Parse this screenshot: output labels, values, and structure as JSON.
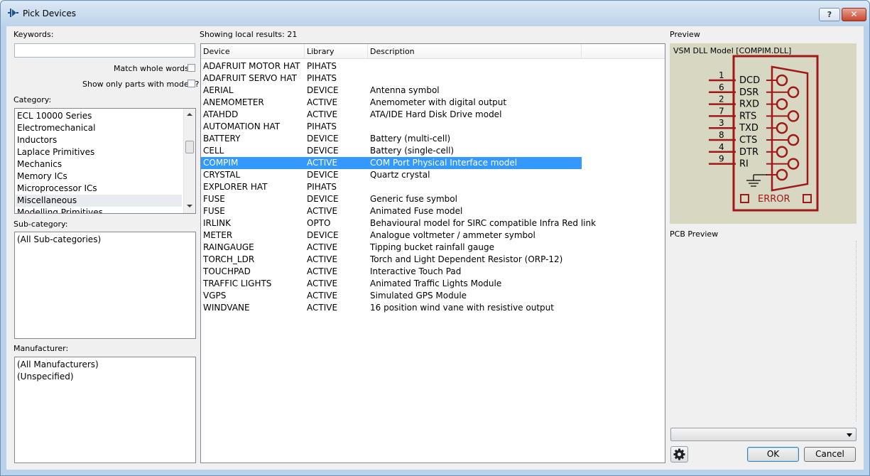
{
  "window": {
    "title": "Pick Devices",
    "help_label": "?",
    "close_label": "✕"
  },
  "search": {
    "keywords_label": "Keywords:",
    "keywords_value": "",
    "match_whole_words_label": "Match whole words?",
    "match_whole_words_checked": false,
    "only_models_label": "Show only parts with models?",
    "only_models_checked": false
  },
  "category": {
    "label": "Category:",
    "items": [
      "ECL 10000 Series",
      "Electromechanical",
      "Inductors",
      "Laplace Primitives",
      "Mechanics",
      "Memory ICs",
      "Microprocessor ICs",
      "Miscellaneous",
      "Modelling Primitives"
    ],
    "selected": "Miscellaneous"
  },
  "subcategory": {
    "label": "Sub-category:",
    "items": [
      "(All Sub-categories)"
    ]
  },
  "manufacturer": {
    "label": "Manufacturer:",
    "items": [
      "(All Manufacturers)",
      "(Unspecified)"
    ]
  },
  "results": {
    "summary": "Showing local results: 21",
    "columns": [
      "Device",
      "Library",
      "Description"
    ],
    "selected_device": "COMPIM",
    "rows": [
      {
        "device": "ADAFRUIT MOTOR HAT",
        "library": "PIHATS",
        "description": ""
      },
      {
        "device": "ADAFRUIT SERVO HAT",
        "library": "PIHATS",
        "description": ""
      },
      {
        "device": "AERIAL",
        "library": "DEVICE",
        "description": "Antenna symbol"
      },
      {
        "device": "ANEMOMETER",
        "library": "ACTIVE",
        "description": "Anemometer with digital output"
      },
      {
        "device": "ATAHDD",
        "library": "ACTIVE",
        "description": "ATA/IDE Hard Disk Drive model"
      },
      {
        "device": "AUTOMATION HAT",
        "library": "PIHATS",
        "description": ""
      },
      {
        "device": "BATTERY",
        "library": "DEVICE",
        "description": "Battery (multi-cell)"
      },
      {
        "device": "CELL",
        "library": "DEVICE",
        "description": "Battery (single-cell)"
      },
      {
        "device": "COMPIM",
        "library": "ACTIVE",
        "description": "COM Port Physical Interface model"
      },
      {
        "device": "CRYSTAL",
        "library": "DEVICE",
        "description": "Quartz crystal"
      },
      {
        "device": "EXPLORER HAT",
        "library": "PIHATS",
        "description": ""
      },
      {
        "device": "FUSE",
        "library": "DEVICE",
        "description": "Generic fuse symbol"
      },
      {
        "device": "FUSE",
        "library": "ACTIVE",
        "description": "Animated Fuse model"
      },
      {
        "device": "IRLINK",
        "library": "OPTO",
        "description": "Behavioural model for SIRC compatible Infra Red link"
      },
      {
        "device": "METER",
        "library": "DEVICE",
        "description": "Analogue voltmeter / ammeter symbol"
      },
      {
        "device": "RAINGAUGE",
        "library": "ACTIVE",
        "description": "Tipping bucket rainfall gauge"
      },
      {
        "device": "TORCH_LDR",
        "library": "ACTIVE",
        "description": "Torch and Light Dependent Resistor (ORP-12)"
      },
      {
        "device": "TOUCHPAD",
        "library": "ACTIVE",
        "description": "Interactive Touch Pad"
      },
      {
        "device": "TRAFFIC LIGHTS",
        "library": "ACTIVE",
        "description": "Animated Traffic Lights Module"
      },
      {
        "device": "VGPS",
        "library": "ACTIVE",
        "description": "Simulated GPS Module"
      },
      {
        "device": "WINDVANE",
        "library": "ACTIVE",
        "description": "16 position wind vane with resistive output"
      }
    ]
  },
  "preview": {
    "label": "Preview",
    "model_caption": "VSM DLL Model [COMPIM.DLL]",
    "pins": [
      {
        "num": "1",
        "name": "DCD"
      },
      {
        "num": "6",
        "name": "DSR"
      },
      {
        "num": "2",
        "name": "RXD"
      },
      {
        "num": "7",
        "name": "RTS"
      },
      {
        "num": "3",
        "name": "TXD"
      },
      {
        "num": "8",
        "name": "CTS"
      },
      {
        "num": "4",
        "name": "DTR"
      },
      {
        "num": "9",
        "name": "RI"
      }
    ],
    "error_label": "ERROR",
    "symbol_color": "#a01818",
    "background_color": "#d8d8c2"
  },
  "pcb_preview": {
    "label": "PCB Preview",
    "package_value": ""
  },
  "buttons": {
    "ok": "OK",
    "cancel": "Cancel"
  },
  "colors": {
    "selection": "#3399ff",
    "title_bar": "#bcd3ea"
  }
}
